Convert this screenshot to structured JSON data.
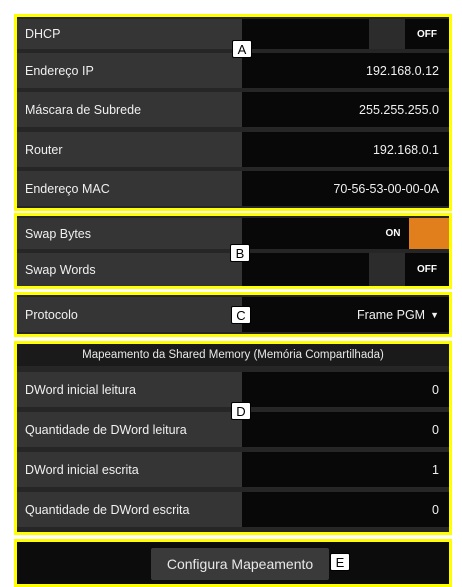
{
  "network": {
    "dhcp_label": "DHCP",
    "dhcp_state": "OFF",
    "ip_label": "Endereço IP",
    "ip_value": "192.168.0.12",
    "mask_label": "Máscara de Subrede",
    "mask_value": "255.255.255.0",
    "router_label": "Router",
    "router_value": "192.168.0.1",
    "mac_label": "Endereço MAC",
    "mac_value": "70-56-53-00-00-0A"
  },
  "swap": {
    "bytes_label": "Swap Bytes",
    "bytes_state": "ON",
    "words_label": "Swap Words",
    "words_state": "OFF"
  },
  "protocol": {
    "label": "Protocolo",
    "value": "Frame PGM"
  },
  "mapping": {
    "header": "Mapeamento da Shared Memory (Memória Compartilhada)",
    "rows": [
      {
        "label": "DWord inicial leitura",
        "value": "0"
      },
      {
        "label": "Quantidade de DWord leitura",
        "value": "0"
      },
      {
        "label": "DWord inicial escrita",
        "value": "1"
      },
      {
        "label": "Quantidade de DWord escrita",
        "value": "0"
      }
    ]
  },
  "actions": {
    "configure_label": "Configura Mapeamento"
  },
  "markers": {
    "a": "A",
    "b": "B",
    "c": "C",
    "d": "D",
    "e": "E"
  },
  "colors": {
    "highlight": "#ffff00",
    "toggle_on": "#e07f1c",
    "panel_bg": "#262626"
  }
}
